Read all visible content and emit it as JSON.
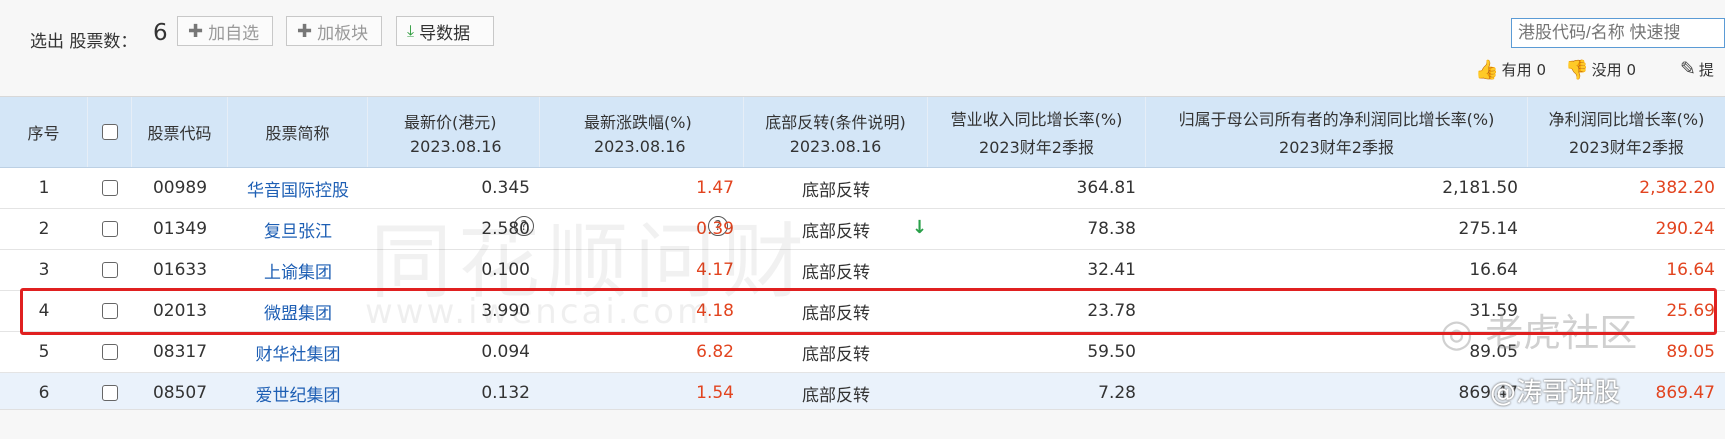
{
  "toolbar": {
    "count_label": "选出 股票数：",
    "count_value": "6",
    "add_watchlist": "加自选",
    "add_sector": "加板块",
    "export": "导数据",
    "search_placeholder": "港股代码/名称 快速搜",
    "useful": "有用",
    "useful_count": "0",
    "useless": "没用",
    "useless_count": "0",
    "suggest": "提"
  },
  "columns": {
    "seq": "序号",
    "code": "股票代码",
    "name": "股票简称",
    "price": [
      "最新价(港元)",
      "2023.08.16"
    ],
    "change": [
      "最新涨跌幅(%)",
      "2023.08.16"
    ],
    "reversal": [
      "底部反转(条件说明)",
      "2023.08.16"
    ],
    "revenue": [
      "营业收入同比增长率(%)",
      "2023财年2季报"
    ],
    "parent_profit": [
      "归属于母公司所有者的净利润同比增长率(%)",
      "2023财年2季报"
    ],
    "net_profit": [
      "净利润同比增长率(%)",
      "2023财年2季报"
    ]
  },
  "rows": [
    {
      "seq": "1",
      "code": "00989",
      "name": "华音国际控股",
      "price": "0.345",
      "change": "1.47",
      "reversal": "底部反转",
      "revenue": "364.81",
      "parent": "2,181.50",
      "net": "2,382.20"
    },
    {
      "seq": "2",
      "code": "01349",
      "name": "复旦张江",
      "price": "2.580",
      "change": "0.39",
      "reversal": "底部反转",
      "revenue": "78.38",
      "parent": "275.14",
      "net": "290.24"
    },
    {
      "seq": "3",
      "code": "01633",
      "name": "上谕集团",
      "price": "0.100",
      "change": "4.17",
      "reversal": "底部反转",
      "revenue": "32.41",
      "parent": "16.64",
      "net": "16.64"
    },
    {
      "seq": "4",
      "code": "02013",
      "name": "微盟集团",
      "price": "3.990",
      "change": "4.18",
      "reversal": "底部反转",
      "revenue": "23.78",
      "parent": "31.59",
      "net": "25.69"
    },
    {
      "seq": "5",
      "code": "08317",
      "name": "财华社集团",
      "price": "0.094",
      "change": "6.82",
      "reversal": "底部反转",
      "revenue": "59.50",
      "parent": "89.05",
      "net": "89.05"
    },
    {
      "seq": "6",
      "code": "08507",
      "name": "爱世纪集团",
      "price": "0.132",
      "change": "1.54",
      "reversal": "底部反转",
      "revenue": "7.28",
      "parent": "869.47",
      "net": "869.47"
    }
  ],
  "watermarks": {
    "brand_cn": "同花顺问财",
    "brand_url": "www.iwencai.com",
    "community": "老虎社区",
    "author": "@涛哥讲股"
  },
  "colors": {
    "header_bg": "#d4e6f7",
    "alt_row_bg": "#eaf2fb",
    "link": "#1e5fb4",
    "up_red": "#e2441f",
    "highlight_border": "#e02020"
  }
}
